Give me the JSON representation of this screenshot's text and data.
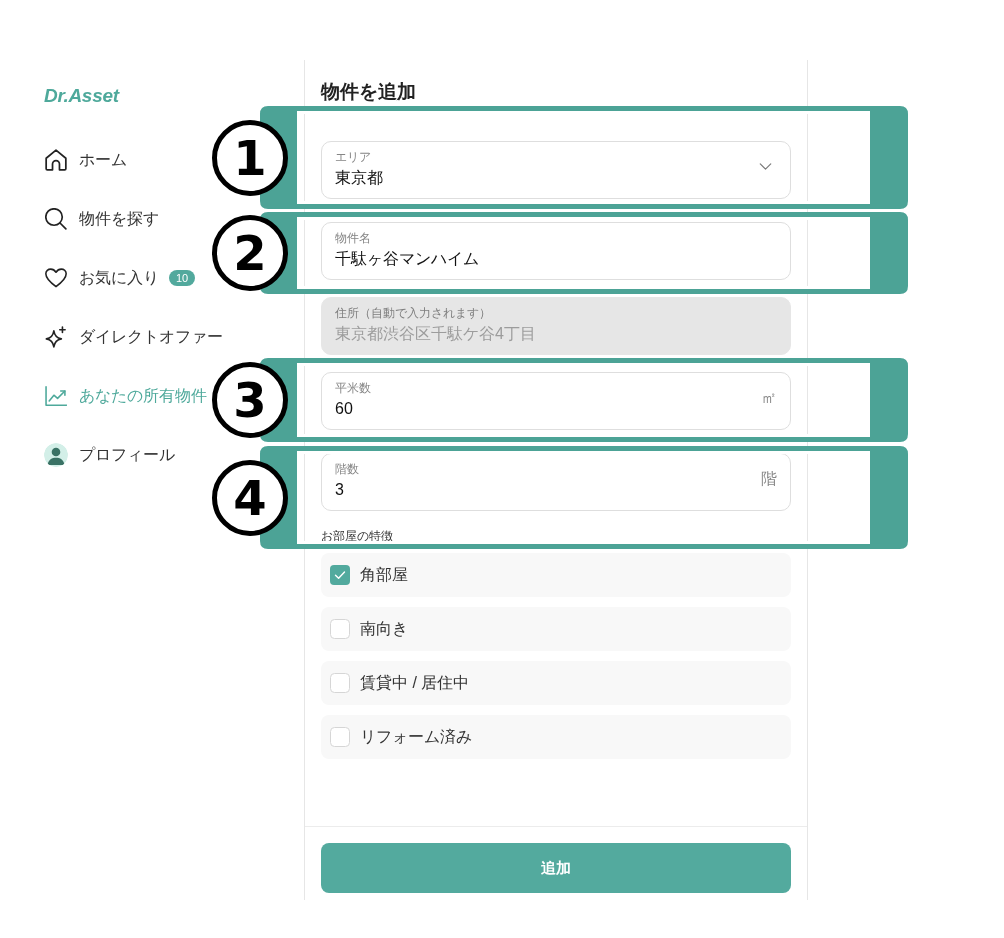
{
  "sidebar": {
    "logo": "Dr.Asset",
    "items": [
      {
        "label": "ホーム",
        "selected": false
      },
      {
        "label": "物件を探す",
        "selected": false
      },
      {
        "label": "お気に入り",
        "badge": "10",
        "selected": false
      },
      {
        "label": "ダイレクトオファー",
        "selected": false
      },
      {
        "label": "あなたの所有物件",
        "selected": true
      },
      {
        "label": "プロフィール",
        "selected": false
      }
    ]
  },
  "form": {
    "title": "物件を追加",
    "fields": [
      {
        "kind": "select",
        "label": "エリア",
        "value": "東京都",
        "disabled": false
      },
      {
        "kind": "text",
        "label": "物件名",
        "value": "千駄ヶ谷マンハイム",
        "disabled": false
      },
      {
        "kind": "text",
        "label": "住所（自動で入力されます）",
        "value": "東京都渋谷区千駄ケ谷4丁目",
        "disabled": true
      },
      {
        "kind": "text",
        "label": "平米数",
        "value": "60",
        "suffix": "㎡",
        "disabled": false
      },
      {
        "kind": "text",
        "label": "階数",
        "value": "3",
        "suffix": "階",
        "disabled": false
      }
    ],
    "features": {
      "label": "お部屋の特徴",
      "options": [
        {
          "label": "角部屋",
          "checked": true
        },
        {
          "label": "南向き",
          "checked": false
        },
        {
          "label": "賃貸中 / 居住中",
          "checked": false
        },
        {
          "label": "リフォーム済み",
          "checked": false
        }
      ]
    },
    "submit": "追加"
  },
  "annotations": [
    {
      "number": "1"
    },
    {
      "number": "2"
    },
    {
      "number": "3"
    },
    {
      "number": "4"
    }
  ]
}
